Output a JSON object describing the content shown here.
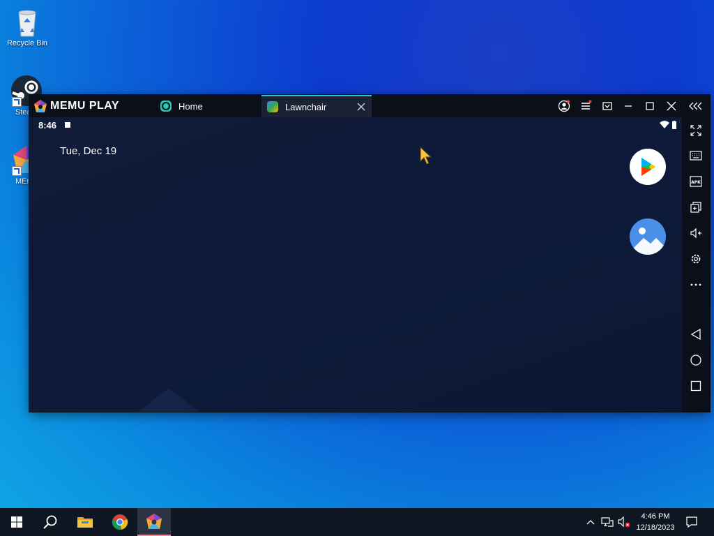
{
  "desktop": {
    "icons": [
      {
        "label": "Recycle Bin",
        "icon": "recycle-bin-icon"
      },
      {
        "label": "Stea",
        "icon": "steam-icon"
      },
      {
        "label": "MEr",
        "icon": "memu-icon"
      }
    ]
  },
  "emulator": {
    "brand": "MEMU PLAY",
    "tabs": [
      {
        "label": "Home",
        "icon": "home-tab-icon",
        "active": false
      },
      {
        "label": "Lawnchair",
        "icon": "lawnchair-icon",
        "active": true
      }
    ],
    "title_controls": [
      "account-icon",
      "menu-icon",
      "screen-record-icon",
      "minimize-icon",
      "maximize-icon",
      "close-icon",
      "collapse-sidebar-icon"
    ],
    "screen": {
      "time": "8:46",
      "date": "Tue, Dec 19",
      "apps": [
        {
          "name": "Play Store",
          "icon": "play-store-icon"
        },
        {
          "name": "Gallery",
          "icon": "gallery-icon"
        }
      ]
    },
    "sidebar": [
      "fullscreen-icon",
      "keyboard-icon",
      "apk-icon",
      "multi-window-icon",
      "volume-up-icon",
      "settings-icon",
      "more-icon",
      "back-icon",
      "home-circle-icon",
      "recents-icon"
    ]
  },
  "taskbar": {
    "items": [
      "windows-start-icon",
      "search-icon",
      "file-explorer-icon",
      "chrome-icon",
      "memu-taskbar-icon"
    ],
    "tray": [
      "chevron-up-icon",
      "network-icon",
      "volume-muted-icon"
    ],
    "time": "4:46 PM",
    "date": "12/18/2023"
  },
  "colors": {
    "accent_tab": "#2bc7b5",
    "taskbar": "#0d1621",
    "window": "#0f182e"
  }
}
